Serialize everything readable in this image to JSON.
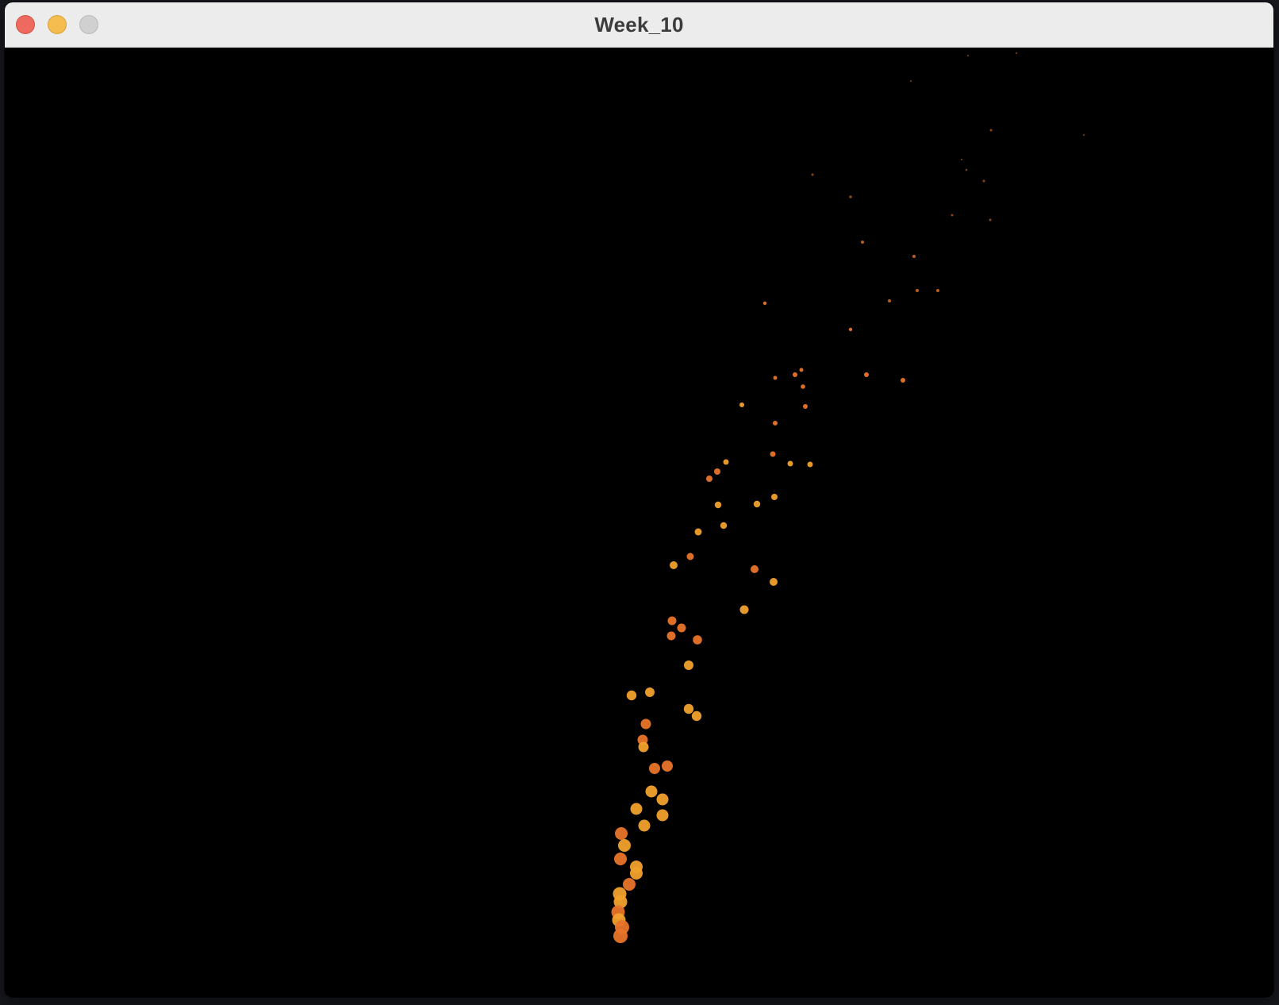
{
  "window": {
    "title": "Week_10",
    "controls": {
      "close": "close-button",
      "minimize": "minimize-button",
      "zoom": "zoom-button"
    }
  },
  "colors": {
    "titlebar": "#ececec",
    "canvas_background": "#000000",
    "particle_orange": "#e8742a",
    "particle_amber": "#f0a12c",
    "particle_dim": "#c4621f"
  }
}
